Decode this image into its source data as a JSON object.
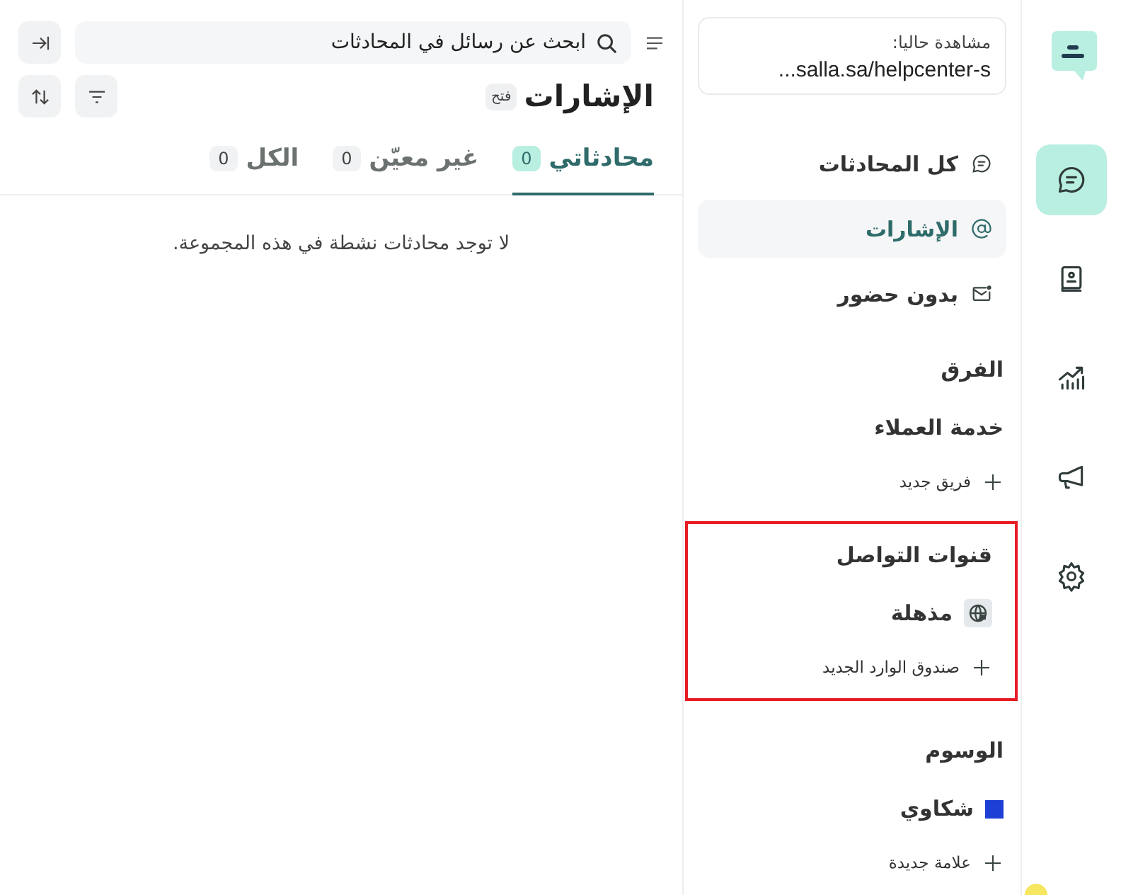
{
  "rail": {
    "items": [
      {
        "kind": "chat",
        "selected": true
      },
      {
        "kind": "contacts",
        "selected": false
      },
      {
        "kind": "reports",
        "selected": false
      },
      {
        "kind": "campaigns",
        "selected": false
      },
      {
        "kind": "settings",
        "selected": false
      }
    ]
  },
  "sidebar": {
    "current_view": {
      "label": "مشاهدة حاليا:",
      "url": "...salla.sa/helpcenter-s"
    },
    "nav": [
      {
        "label": "كل المحادثات",
        "kind": "chat",
        "selected": false
      },
      {
        "label": "الإشارات",
        "kind": "mention",
        "selected": true
      },
      {
        "label": "بدون حضور",
        "kind": "unattended",
        "selected": false
      }
    ],
    "sections": [
      {
        "title": "الفرق",
        "highlighted": false,
        "items": [
          {
            "label": "خدمة العملاء",
            "kind": "team"
          }
        ],
        "add": "فريق جديد"
      },
      {
        "title": "قنوات التواصل",
        "highlighted": true,
        "items": [
          {
            "label": "مذهلة",
            "kind": "web"
          }
        ],
        "add": "صندوق الوارد الجديد"
      },
      {
        "title": "الوسوم",
        "highlighted": false,
        "items": [
          {
            "label": "شكاوي",
            "kind": "label",
            "color": "#1d3fd6"
          }
        ],
        "add": "علامة جديدة"
      }
    ]
  },
  "search": {
    "placeholder": "ابحث عن رسائل في المحادثات"
  },
  "header": {
    "title": "الإشارات",
    "status": "فتح"
  },
  "tabs": [
    {
      "label": "محادثاتي",
      "count": "0",
      "selected": true
    },
    {
      "label": "غير معيّن",
      "count": "0",
      "selected": false
    },
    {
      "label": "الكل",
      "count": "0",
      "selected": false
    }
  ],
  "empty_message": "لا توجد محادثات نشطة في هذه المجموعة."
}
